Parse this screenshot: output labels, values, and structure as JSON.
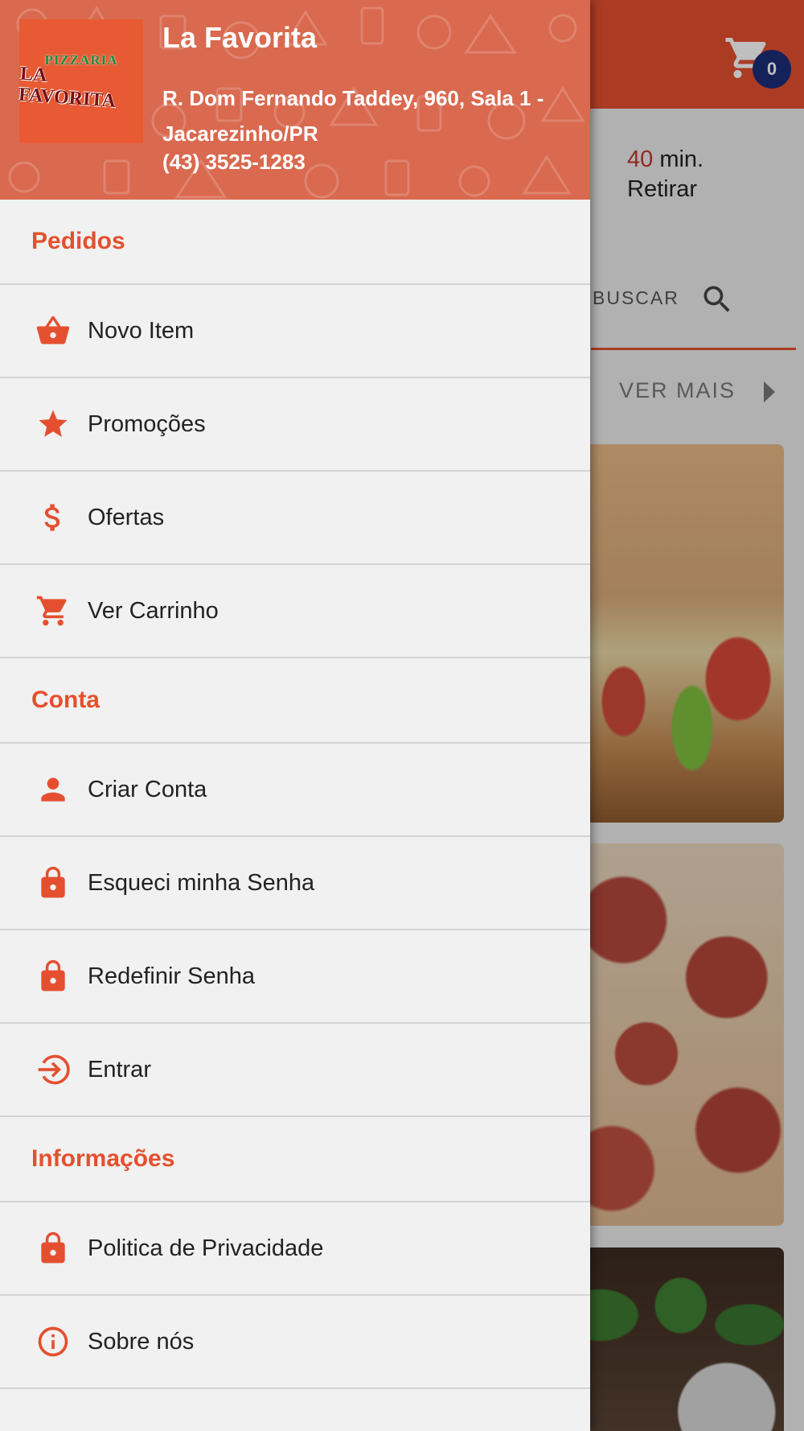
{
  "app": {
    "cart_count": "0",
    "delivery_time_value": "40",
    "delivery_time_unit": "min.",
    "delivery_mode": "Retirar",
    "search_label": "BUSCAR",
    "see_more_label": "VER MAIS",
    "accent_color": "#e4502f",
    "badge_color": "#1d2d77"
  },
  "drawer": {
    "logo_top": "PIZZARIA",
    "logo_main": "LA FAVORITA",
    "store_name": "La Favorita",
    "store_address": "R. Dom Fernando Taddey, 960, Sala 1 - Jacarezinho/PR",
    "store_phone": "(43) 3525-1283",
    "sections": [
      {
        "title": "Pedidos",
        "items": [
          {
            "label": "Novo Item",
            "icon": "basket-icon"
          },
          {
            "label": "Promoções",
            "icon": "star-icon"
          },
          {
            "label": "Ofertas",
            "icon": "dollar-icon"
          },
          {
            "label": "Ver Carrinho",
            "icon": "cart-icon"
          }
        ]
      },
      {
        "title": "Conta",
        "items": [
          {
            "label": "Criar Conta",
            "icon": "person-icon"
          },
          {
            "label": "Esqueci minha Senha",
            "icon": "lock-icon"
          },
          {
            "label": "Redefinir Senha",
            "icon": "lock-icon"
          },
          {
            "label": "Entrar",
            "icon": "login-icon"
          }
        ]
      },
      {
        "title": "Informações",
        "items": [
          {
            "label": "Politica de Privacidade",
            "icon": "lock-icon"
          },
          {
            "label": "Sobre nós",
            "icon": "info-icon"
          }
        ]
      }
    ]
  }
}
